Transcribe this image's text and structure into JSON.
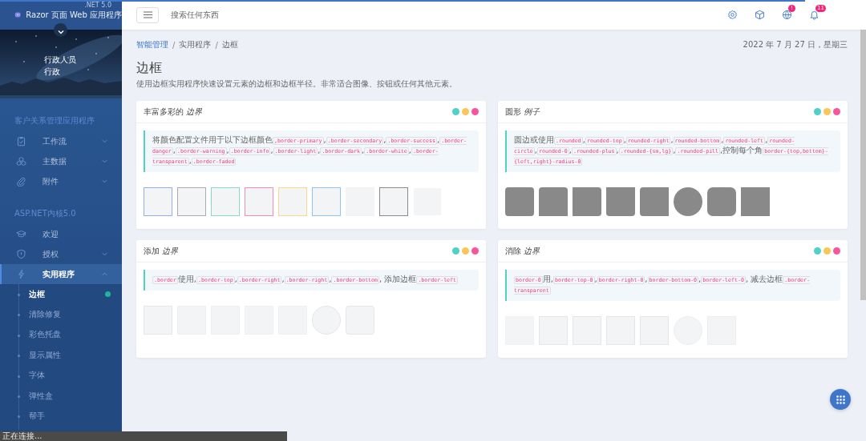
{
  "progress": {
    "level": 0.93
  },
  "sidebar": {
    "version": ".NET 5.0",
    "app_title": "Razor 页面 Web 应用程序",
    "profile": {
      "name": "行政人员",
      "role": "行政"
    },
    "sections": [
      {
        "label": "客户关系管理应用程序",
        "items": [
          {
            "label": "工作流",
            "expanded": false,
            "selected": false,
            "has_children": true
          },
          {
            "label": "主数据",
            "expanded": false,
            "selected": false,
            "has_children": true
          },
          {
            "label": "附件",
            "expanded": false,
            "selected": false,
            "has_children": true
          }
        ]
      },
      {
        "label": "ASP.NET内核5.0",
        "items": [
          {
            "label": "欢迎",
            "selected": false,
            "has_children": false
          },
          {
            "label": "授权",
            "expanded": false,
            "selected": false,
            "has_children": true
          },
          {
            "label": "实用程序",
            "expanded": true,
            "selected": true,
            "has_children": true,
            "children": [
              {
                "label": "边框",
                "selected": true
              },
              {
                "label": "清除修复",
                "selected": false
              },
              {
                "label": "彩色托盘",
                "selected": false
              },
              {
                "label": "显示属性",
                "selected": false
              },
              {
                "label": "字体",
                "selected": false
              },
              {
                "label": "弹性盒",
                "selected": false
              },
              {
                "label": "帮手",
                "selected": false
              }
            ]
          }
        ]
      }
    ]
  },
  "topbar": {
    "search": {
      "placeholder": "搜索任何东西"
    },
    "icons": [
      {
        "kind": "gear"
      },
      {
        "kind": "cube"
      },
      {
        "kind": "globe",
        "badge": "!"
      },
      {
        "kind": "bell",
        "badge": "11"
      }
    ]
  },
  "breadcrumb": [
    {
      "label": "智能管理",
      "link": true
    },
    {
      "separator": "/",
      "label": "实用程序",
      "link": false
    },
    {
      "separator": "/",
      "label": "边框",
      "link": false
    }
  ],
  "date": "2022 年 7 月 27 日，星期三",
  "page": {
    "title": "边框",
    "subtitle": "使用边框实用程序快速设置元素的边框和边框半径。非常适合图像、按钮或任何其他元素。"
  },
  "cards": [
    {
      "title": "丰富多彩的 *边界*",
      "filled": false,
      "dots": [
        {
          "color": "#4fd1c5"
        },
        {
          "color": "#fbc658"
        },
        {
          "color": "#f8559b"
        }
      ],
      "description": [
        {
          "kind": "text",
          "text": "将颜色配置文件用于以下边框颜色"
        },
        {
          "kind": "code",
          "text": ",border-primary"
        },
        {
          "kind": "text",
          "text": ","
        },
        {
          "kind": "code",
          "text": ".border-secondary"
        },
        {
          "kind": "text",
          "text": ","
        },
        {
          "kind": "code",
          "text": ".border-success"
        },
        {
          "kind": "text",
          "text": ","
        },
        {
          "kind": "code",
          "text": ".border-danger"
        },
        {
          "kind": "text",
          "text": ","
        },
        {
          "kind": "code",
          "text": ".border-warning"
        },
        {
          "kind": "text",
          "text": ","
        },
        {
          "kind": "code",
          "text": ".border-info"
        },
        {
          "kind": "text",
          "text": ","
        },
        {
          "kind": "code",
          "text": ".border-light"
        },
        {
          "kind": "text",
          "text": ","
        },
        {
          "kind": "code",
          "text": ".border-dark"
        },
        {
          "kind": "text",
          "text": ","
        },
        {
          "kind": "code",
          "text": ".border-white"
        },
        {
          "kind": "text",
          "text": ","
        },
        {
          "kind": "code",
          "text": ".border-transparent"
        },
        {
          "kind": "text",
          "text": ","
        },
        {
          "kind": "code",
          "text": ".border-faded"
        }
      ],
      "samples": [
        {
          "kind": "square",
          "color": "#8fb0e8"
        },
        {
          "kind": "square",
          "color": "#a9abb0"
        },
        {
          "kind": "square",
          "color": "#85dccb"
        },
        {
          "kind": "square",
          "color": "#f58cb8"
        },
        {
          "kind": "square",
          "color": "#f9d88c"
        },
        {
          "kind": "square",
          "color": "#8dc4f2"
        },
        {
          "kind": "square",
          "color": "#f1f2f4"
        },
        {
          "kind": "square",
          "color": "#8a8a8a"
        },
        {
          "kind": "square",
          "color": "#ffffff"
        }
      ]
    },
    {
      "title": "圆形 *例子*",
      "filled": true,
      "dots": [
        {
          "color": "#4fd1c5"
        },
        {
          "color": "#fbc658"
        },
        {
          "color": "#f8559b"
        }
      ],
      "description": [
        {
          "kind": "text",
          "text": "圆边或使用"
        },
        {
          "kind": "code",
          "text": ".rounded"
        },
        {
          "kind": "text",
          "text": ","
        },
        {
          "kind": "code",
          "text": "rounded-top"
        },
        {
          "kind": "text",
          "text": ","
        },
        {
          "kind": "code",
          "text": "rounded-right"
        },
        {
          "kind": "text",
          "text": ","
        },
        {
          "kind": "code",
          "text": "rounded-bottom"
        },
        {
          "kind": "text",
          "text": ","
        },
        {
          "kind": "code",
          "text": "rounded-left"
        },
        {
          "kind": "text",
          "text": ","
        },
        {
          "kind": "code",
          "text": "rounded-circle"
        },
        {
          "kind": "text",
          "text": ","
        },
        {
          "kind": "code",
          "text": "rounded-0"
        },
        {
          "kind": "text",
          "text": ","
        },
        {
          "kind": "code",
          "text": ".rounded-plus"
        },
        {
          "kind": "text",
          "text": ","
        },
        {
          "kind": "code",
          "text": ".rounded-{sm,lg}"
        },
        {
          "kind": "text",
          "text": ","
        },
        {
          "kind": "code",
          "text": ".rounded-pill"
        },
        {
          "kind": "text",
          "text": ",控制每个角"
        },
        {
          "kind": "code",
          "text": "border-{top,bottom}-{left,right}-radius-0"
        }
      ],
      "samples": [
        {
          "kind": "rounded"
        },
        {
          "kind": "rounded-top"
        },
        {
          "kind": "rounded-right"
        },
        {
          "kind": "rounded-bottom"
        },
        {
          "kind": "rounded-left"
        },
        {
          "kind": "circle"
        },
        {
          "kind": "rounded-plus"
        },
        {
          "kind": "square"
        }
      ]
    },
    {
      "title": "添加 *边界*",
      "filled": false,
      "dots": [
        {
          "color": "#4fd1c5"
        },
        {
          "color": "#fbc658"
        },
        {
          "color": "#f8559b"
        }
      ],
      "description": [
        {
          "kind": "code",
          "text": ".border"
        },
        {
          "kind": "text",
          "text": "使用,"
        },
        {
          "kind": "code",
          "text": ".border-top"
        },
        {
          "kind": "text",
          "text": ","
        },
        {
          "kind": "code",
          "text": ".border-right"
        },
        {
          "kind": "text",
          "text": ","
        },
        {
          "kind": "code",
          "text": ".border-right"
        },
        {
          "kind": "text",
          "text": ","
        },
        {
          "kind": "code",
          "text": ".border-bottom"
        },
        {
          "kind": "text",
          "text": ", 添加边框"
        },
        {
          "kind": "code",
          "text": ".border-left"
        }
      ],
      "samples": [
        {
          "kind": "square",
          "color": "#e4e6ea"
        },
        {
          "kind": "square",
          "color": "#eef0f3"
        },
        {
          "kind": "square",
          "color": "#eef0f3"
        },
        {
          "kind": "square",
          "color": "#eef0f3"
        },
        {
          "kind": "square",
          "color": "#eef0f3"
        },
        {
          "kind": "circle",
          "color": "#e4e6ea"
        },
        {
          "kind": "rounded",
          "color": "#e4e6ea"
        }
      ]
    },
    {
      "title": "消除 *边界*",
      "filled": false,
      "dots": [
        {
          "color": "#4fd1c5"
        },
        {
          "color": "#fbc658"
        },
        {
          "color": "#f8559b"
        }
      ],
      "description": [
        {
          "kind": "code",
          "text": "border-0"
        },
        {
          "kind": "text",
          "text": "用,"
        },
        {
          "kind": "code",
          "text": "border-top-0"
        },
        {
          "kind": "text",
          "text": ","
        },
        {
          "kind": "code",
          "text": "border-right-0"
        },
        {
          "kind": "text",
          "text": ","
        },
        {
          "kind": "code",
          "text": "border-bottom-0"
        },
        {
          "kind": "text",
          "text": ","
        },
        {
          "kind": "code",
          "text": "border-left-0"
        },
        {
          "kind": "text",
          "text": ", 减去边框"
        },
        {
          "kind": "code",
          "text": ".border-transparent"
        }
      ],
      "samples": [
        {
          "kind": "square",
          "color": "#f1f2f4"
        },
        {
          "kind": "square",
          "color": "#e4e6ea"
        },
        {
          "kind": "square",
          "color": "#e4e6ea"
        },
        {
          "kind": "square",
          "color": "#e4e6ea"
        },
        {
          "kind": "square",
          "color": "#e4e6ea"
        },
        {
          "kind": "circle",
          "color": "#eceef1"
        },
        {
          "kind": "square",
          "color": "#eceef1"
        }
      ]
    }
  ],
  "status_bar": {
    "text": "正在连接..."
  }
}
